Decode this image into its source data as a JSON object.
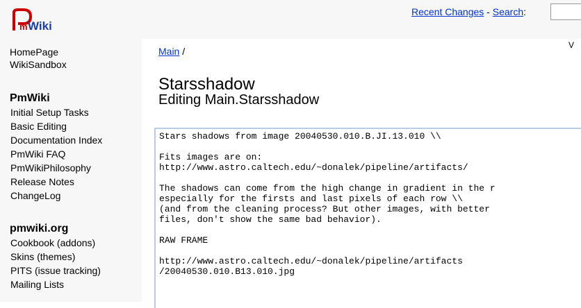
{
  "header": {
    "logo_text": "PmWiki",
    "nav": {
      "recent_changes": "Recent Changes",
      "separator": " - ",
      "search_label": "Search",
      "search_suffix": ":"
    },
    "search": {
      "value": "",
      "placeholder": ""
    }
  },
  "sidebar": {
    "top_links": [
      "HomePage",
      "WikiSandbox"
    ],
    "pmwiki_heading": "PmWiki",
    "pmwiki_links": [
      "Initial Setup Tasks",
      "Basic Editing",
      "Documentation Index",
      "PmWiki FAQ",
      "PmWikiPhilosophy",
      "Release Notes",
      "ChangeLog"
    ],
    "pmwikiorg_heading": "pmwiki.org",
    "pmwikiorg_links": [
      "Cookbook (addons)",
      "Skins (themes)",
      "PITS (issue tracking)",
      "Mailing Lists"
    ]
  },
  "main": {
    "breadcrumb_group": "Main",
    "breadcrumb_sep": " /",
    "page_title": "Starsshadow",
    "edit_heading": "Editing Main.Starsshadow",
    "corner_text": "V",
    "edit_text": "Stars shadows from image 20040530.010.B.JI.13.010 \\\\\n\nFits images are on:\nhttp://www.astro.caltech.edu/~donalek/pipeline/artifacts/\n\nThe shadows can come from the high change in gradient in the r\nespecially for the firsts and last pixels of each row \\\\\n(and from the cleaning process? But other images, with better\nfiles, don't show the same bad behavior).\n\nRAW FRAME\n\nhttp://www.astro.caltech.edu/~donalek/pipeline/artifacts\n/20040530.010.B13.010.jpg"
  },
  "colors": {
    "link": "#0033cc",
    "logo_red": "#cc0000",
    "logo_blue": "#1a3fa8",
    "panel_bg": "#f7f7f7",
    "textarea_border": "#b8cde3"
  }
}
